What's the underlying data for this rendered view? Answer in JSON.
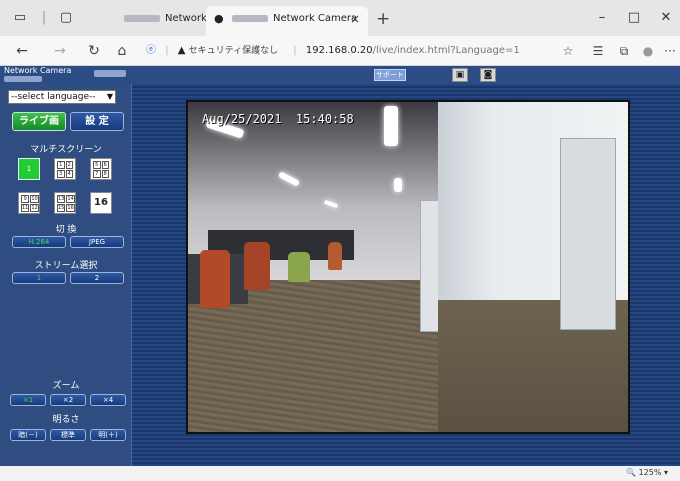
{
  "browser": {
    "tabs": [
      {
        "title": "Network Camera",
        "active": false
      },
      {
        "title": "Network Camera",
        "active": true
      }
    ],
    "security_label": "セキュリティ保護なし",
    "url_host": "192.168.0.20",
    "url_path": "/live/index.html?Language=1",
    "zoom": "125%"
  },
  "camera": {
    "brand": "Network Camera",
    "support_label": "サポート",
    "language_select": "--select language--",
    "live_label": "ライブ画",
    "setup_label": "設 定",
    "multiscreen_title": "マルチスクリーン",
    "multiscreen_buttons": [
      {
        "label": "1"
      },
      {
        "label": "1 2 3 4"
      },
      {
        "label": "5 6 7 8"
      },
      {
        "label": "9 10 11 12"
      },
      {
        "label": "13 14 15 16"
      },
      {
        "label": "16"
      }
    ],
    "switch_title": "切 換",
    "format_buttons": [
      "H.264",
      "JPEG"
    ],
    "stream_title": "ストリーム選択",
    "stream_buttons": [
      "1",
      "2"
    ],
    "zoom_title": "ズーム",
    "zoom_buttons": [
      "×1",
      "×2",
      "×4"
    ],
    "brightness_title": "明るさ",
    "brightness_buttons": [
      "暗(－)",
      "標準",
      "明(＋)"
    ],
    "osd_text": "Aug/25/2021  15:40:58"
  },
  "colors": {
    "live_active": "#22a832",
    "page_bg": "#1a3568",
    "sidebar_bg": "#2f4d80"
  }
}
